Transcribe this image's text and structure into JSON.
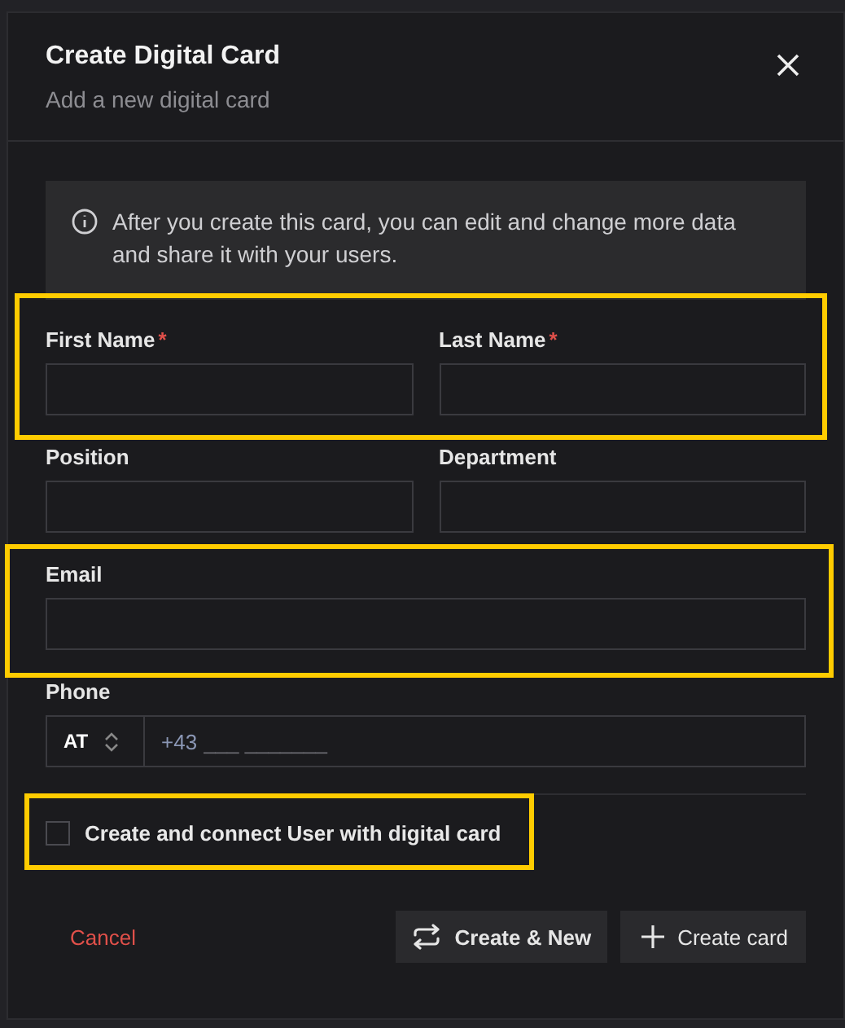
{
  "dialog": {
    "title": "Create Digital Card",
    "subtitle": "Add a new digital card"
  },
  "info": {
    "text": "After you create this card, you can edit and change more data and share it with your users."
  },
  "field_rows": [
    {
      "highlighted": true,
      "fields": [
        {
          "label": "First Name",
          "required_mark": "*"
        },
        {
          "label": "Last Name",
          "required_mark": "*"
        }
      ]
    },
    {
      "highlighted": false,
      "fields": [
        {
          "label": "Position"
        },
        {
          "label": "Department"
        }
      ]
    },
    {
      "highlighted": true,
      "fields": [
        {
          "label": "Email"
        }
      ]
    }
  ],
  "phone": {
    "label": "Phone",
    "country": "AT",
    "prefix": "+43",
    "placeholder": "___ _______"
  },
  "connect_user": {
    "label": "Create and connect User with digital card",
    "checked": false,
    "highlighted": true
  },
  "actions": {
    "cancel": "Cancel",
    "buttons": [
      {
        "kind": "repeat",
        "label": "Create & New"
      },
      {
        "kind": "plus",
        "label": "Create card"
      }
    ]
  }
}
